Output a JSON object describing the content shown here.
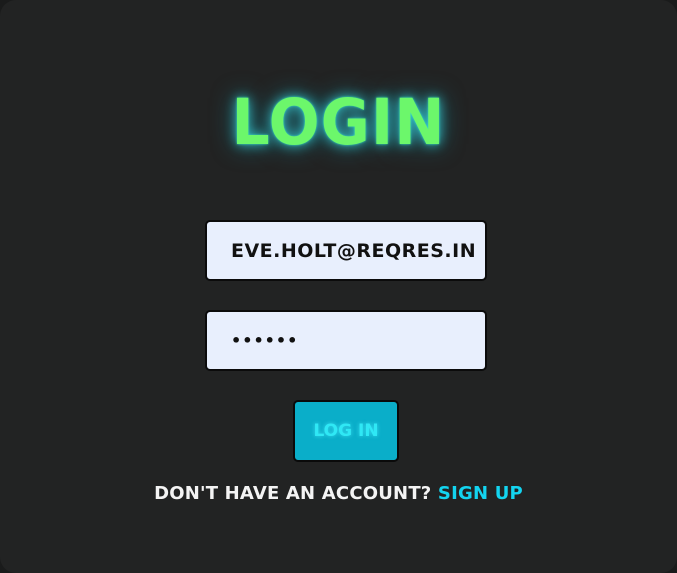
{
  "header": {
    "title": "LOGIN"
  },
  "form": {
    "email_value": "EVE.HOLT@REQRES.IN",
    "password_value": "••••••",
    "login_label": "LOG IN"
  },
  "footer": {
    "prompt": "DON'T HAVE AN ACCOUNT?",
    "signup_label": "SIGN UP"
  },
  "colors": {
    "background": "#222323",
    "title": "#6cf76b",
    "title_glow": "#3cdce6",
    "input_bg": "#e8effd",
    "button_bg": "#0aaec9",
    "button_text": "#2fe8f5",
    "link": "#13d4f0",
    "text": "#f4f4f4"
  }
}
